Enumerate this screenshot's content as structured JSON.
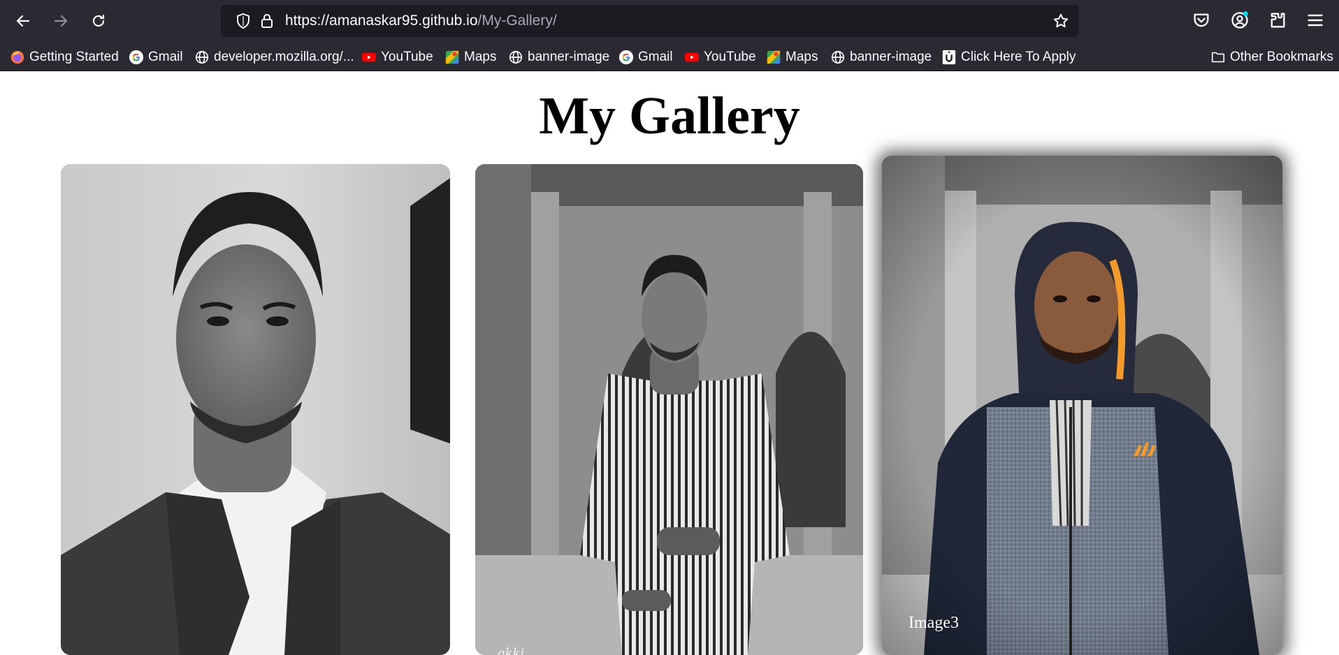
{
  "browser": {
    "url_host": "https://amanaskar95.github.io",
    "url_path": "/My-Gallery/",
    "bookmarks": [
      {
        "label": "Getting Started",
        "icon": "firefox-icon"
      },
      {
        "label": "Gmail",
        "icon": "google-icon"
      },
      {
        "label": "developer.mozilla.org/...",
        "icon": "globe-icon"
      },
      {
        "label": "YouTube",
        "icon": "youtube-icon"
      },
      {
        "label": "Maps",
        "icon": "maps-icon"
      },
      {
        "label": "banner-image",
        "icon": "globe-icon"
      },
      {
        "label": "Gmail",
        "icon": "google-icon"
      },
      {
        "label": "YouTube",
        "icon": "youtube-icon"
      },
      {
        "label": "Maps",
        "icon": "maps-icon"
      },
      {
        "label": "banner-image",
        "icon": "globe-icon"
      },
      {
        "label": "Click Here To Apply",
        "icon": "u-icon"
      }
    ],
    "other_bookmarks": "Other Bookmarks"
  },
  "page": {
    "title": "My Gallery",
    "cards": [
      {
        "caption": "",
        "signature": ""
      },
      {
        "caption": "",
        "signature": "akki"
      },
      {
        "caption": "Image3",
        "signature": ""
      }
    ]
  },
  "colors": {
    "chrome_bg": "#2b2a33",
    "urlbar_bg": "#1c1b22",
    "chrome_text": "#fbfbfe",
    "page_bg": "#ffffff"
  }
}
